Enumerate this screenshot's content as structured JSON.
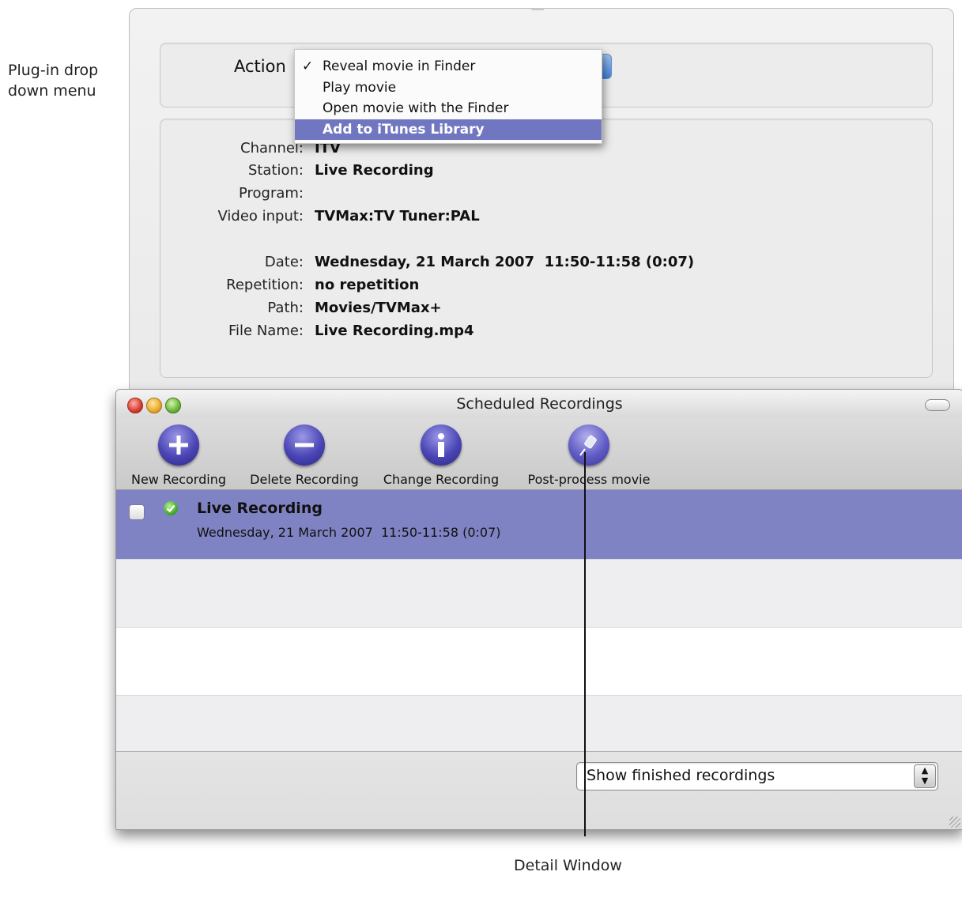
{
  "annotations": {
    "plugin_menu_line1": "Plug-in drop",
    "plugin_menu_line2": "down menu",
    "detail_window": "Detail Window"
  },
  "detail": {
    "action_label": "Action",
    "menu": {
      "items": [
        {
          "label": "Reveal movie in Finder",
          "checked": true
        },
        {
          "label": "Play movie"
        },
        {
          "label": "Open movie with the Finder"
        },
        {
          "label": "Add to iTunes Library",
          "highlighted": true
        }
      ],
      "check_glyph": "✓"
    },
    "fields": [
      {
        "label": "Channel:",
        "value": "ITV"
      },
      {
        "label": "Station:",
        "value": "Live Recording"
      },
      {
        "label": "Program:",
        "value": ""
      },
      {
        "label": "Video input:",
        "value": "TVMax:TV Tuner:PAL"
      },
      {
        "label": "Date:",
        "value": "Wednesday, 21 March 2007  11:50-11:58 (0:07)"
      },
      {
        "label": "Repetition:",
        "value": "no repetition"
      },
      {
        "label": "Path:",
        "value": "Movies/TVMax+"
      },
      {
        "label": "File Name:",
        "value": "Live Recording.mp4"
      }
    ]
  },
  "window": {
    "title": "Scheduled Recordings",
    "toolbar": {
      "new": "New Recording",
      "delete": "Delete Recording",
      "change": "Change Recording",
      "postprocess": "Post-process movie"
    },
    "recording": {
      "title": "Live Recording",
      "date": "Wednesday, 21 March 2007  11:50-11:58 (0:07)"
    },
    "filter_selected": "Show finished recordings"
  },
  "colors": {
    "selection": "#7f83c3",
    "menu_highlight": "#7077c0",
    "toolbar_icon": "#4a45b4"
  }
}
